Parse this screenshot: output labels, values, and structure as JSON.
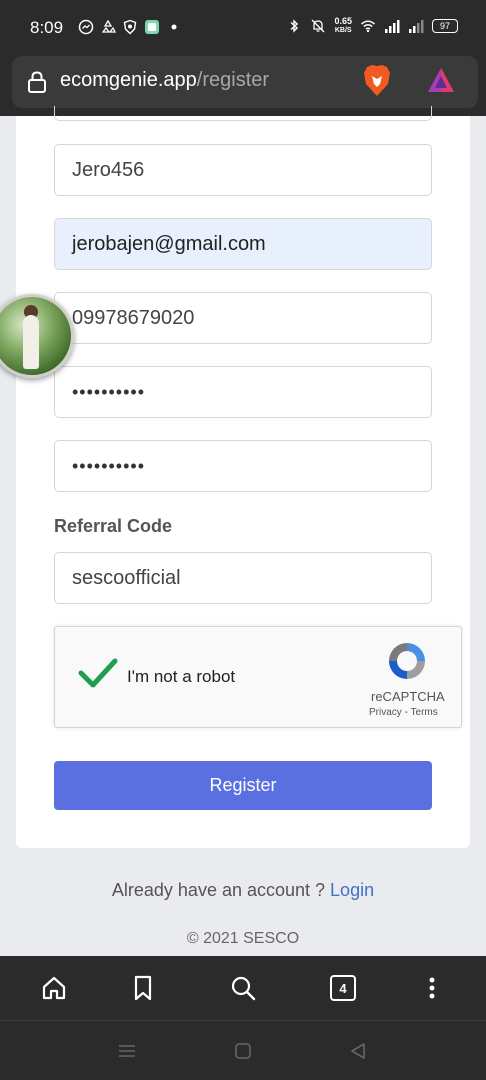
{
  "status_bar": {
    "time": "8:09",
    "net_speed_value": "0.65",
    "net_speed_unit": "KB/S",
    "battery": "97"
  },
  "browser": {
    "url_host": "ecomgenie.app",
    "url_path": "/register"
  },
  "form": {
    "username_value": "Jero456",
    "email_value": "jerobajen@gmail.com",
    "phone_value": "09978679020",
    "password_value": "••••••••••",
    "confirm_password_value": "••••••••••",
    "referral_label": "Referral Code",
    "referral_value": "sescoofficial",
    "register_label": "Register"
  },
  "captcha": {
    "label": "I'm not a robot",
    "brand": "reCAPTCHA",
    "privacy": "Privacy",
    "separator": " - ",
    "terms": "Terms"
  },
  "footer": {
    "login_prompt": "Already have an account ? ",
    "login_link": "Login",
    "copyright": "© 2021 SESCO"
  },
  "toolbar": {
    "tab_count": "4"
  },
  "colors": {
    "primary_button": "#5a6fe0",
    "link": "#3f72c8",
    "autofill_bg": "#e8f0fe",
    "chrome_dark": "#2b2b2b"
  }
}
